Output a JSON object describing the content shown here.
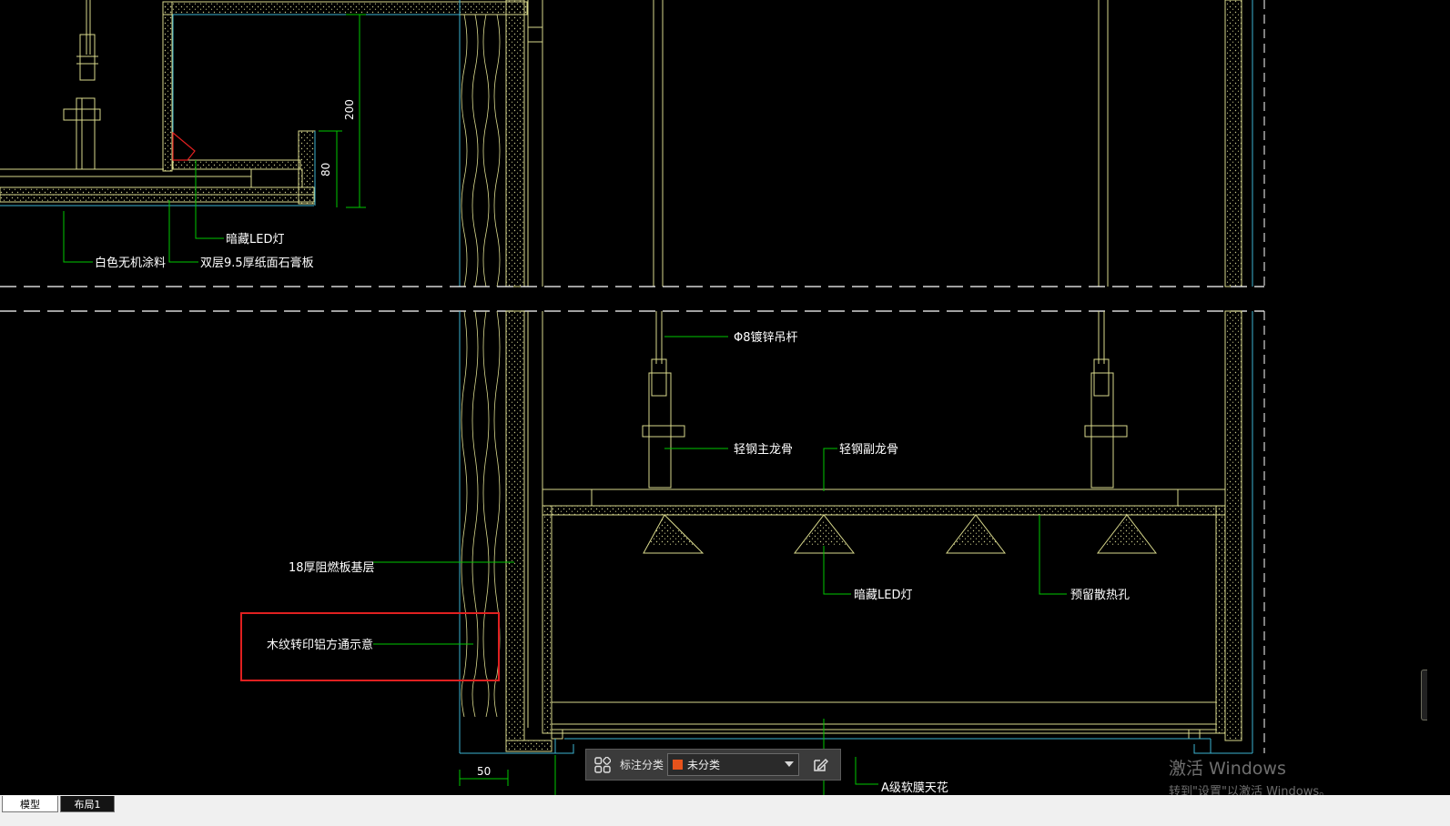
{
  "drawing": {
    "labels": {
      "coating": "白色无机涂料",
      "gypsum_board": "双层9.5厚纸面石膏板",
      "led_top": "暗藏LED灯",
      "rod": "Φ8镀锌吊杆",
      "main_keel": "轻钢主龙骨",
      "sub_keel": "轻钢副龙骨",
      "plywood_base": "18厚阻燃板基层",
      "wood_grain_aluminum": "木纹转印铝方通示意",
      "led_bottom": "暗藏LED灯",
      "vent_hole": "预留散热孔",
      "soft_film_ceiling": "A级软膜天花"
    },
    "dimensions": {
      "height_200": "200",
      "height_80": "80",
      "width_50": "50"
    }
  },
  "toolbar": {
    "category_label": "标注分类",
    "selected_category": "未分类",
    "swatch_color": "#e8531c"
  },
  "watermark": {
    "line1": "激活 Windows",
    "line2": "转到\"设置\"以激活 Windows。"
  },
  "tabs": {
    "model": "模型",
    "layout1": "布局1"
  },
  "colors": {
    "background": "#000000",
    "outline_yellow": "#d9d98c",
    "leader_green": "#00c800",
    "cyan_line": "#3cb4d2",
    "highlight_red": "#e02020"
  }
}
